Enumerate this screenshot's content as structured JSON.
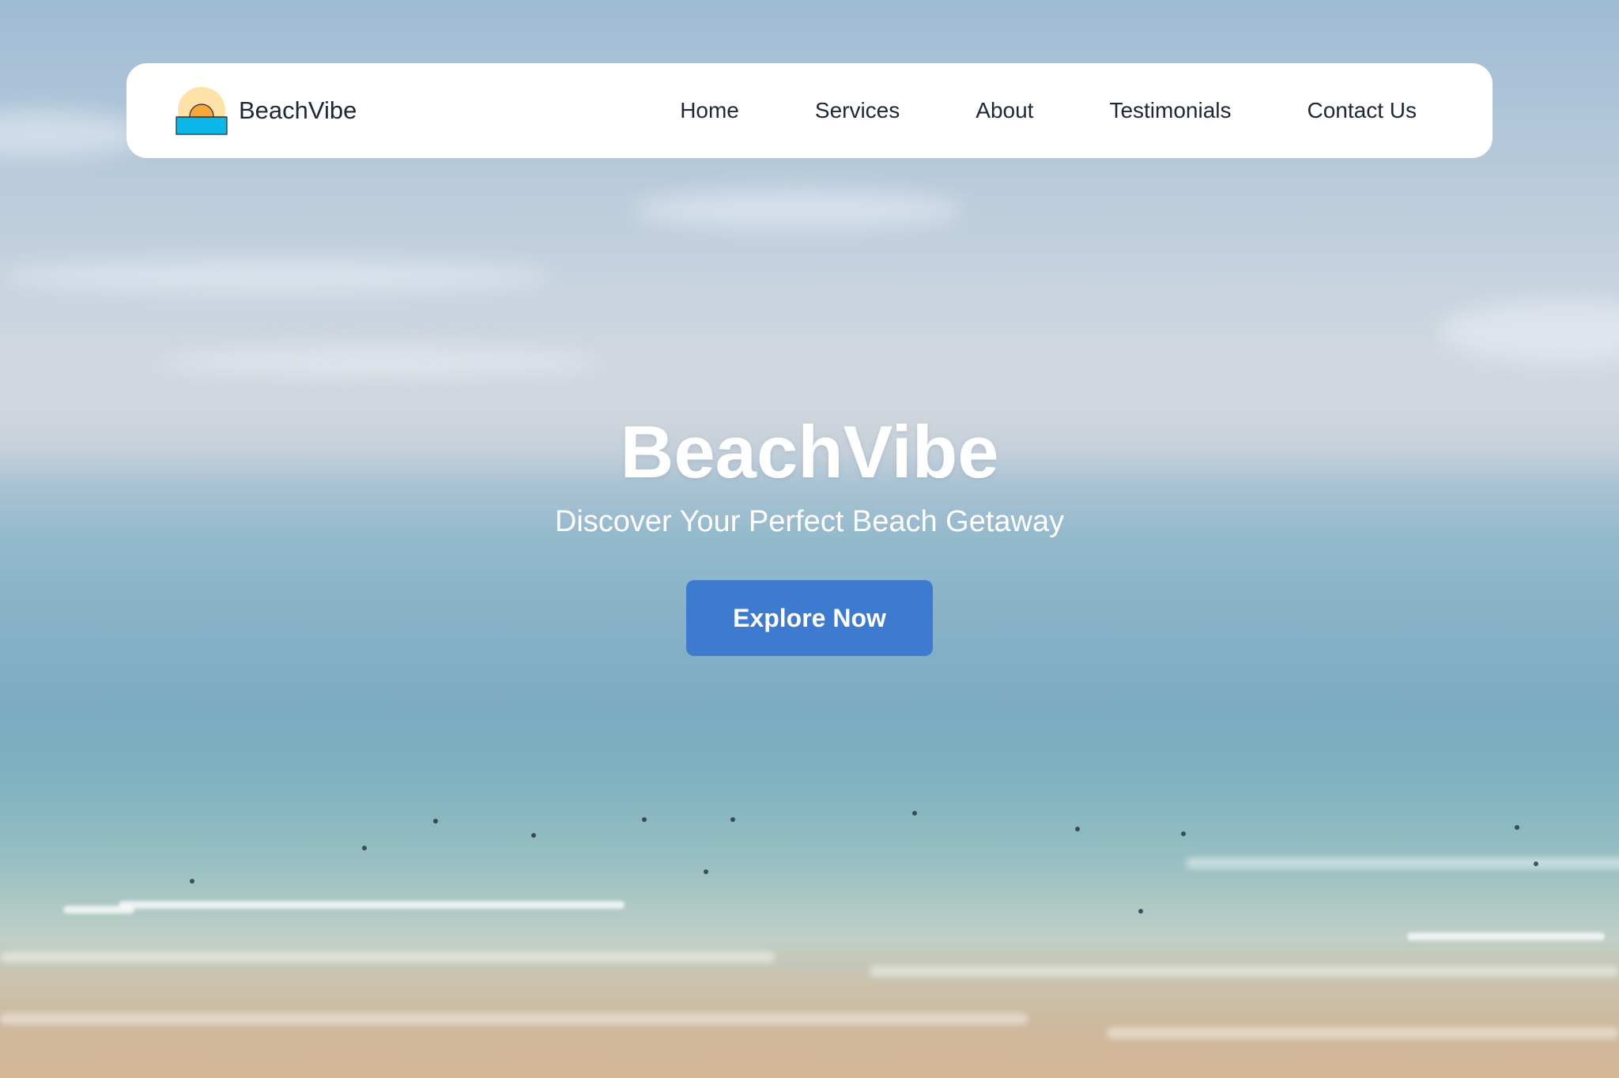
{
  "brand": {
    "name": "BeachVibe",
    "logo_icon": "sunset-over-water-icon"
  },
  "nav": {
    "items": [
      {
        "label": "Home"
      },
      {
        "label": "Services"
      },
      {
        "label": "About"
      },
      {
        "label": "Testimonials"
      },
      {
        "label": "Contact Us"
      }
    ]
  },
  "hero": {
    "title": "BeachVibe",
    "subtitle": "Discover Your Perfect Beach Getaway",
    "cta_label": "Explore Now",
    "background": "ocean-beach-photo"
  },
  "colors": {
    "accent": "#3d7bd0",
    "nav_bg": "#ffffff",
    "nav_text": "#1e2738",
    "hero_text": "#ffffff"
  }
}
